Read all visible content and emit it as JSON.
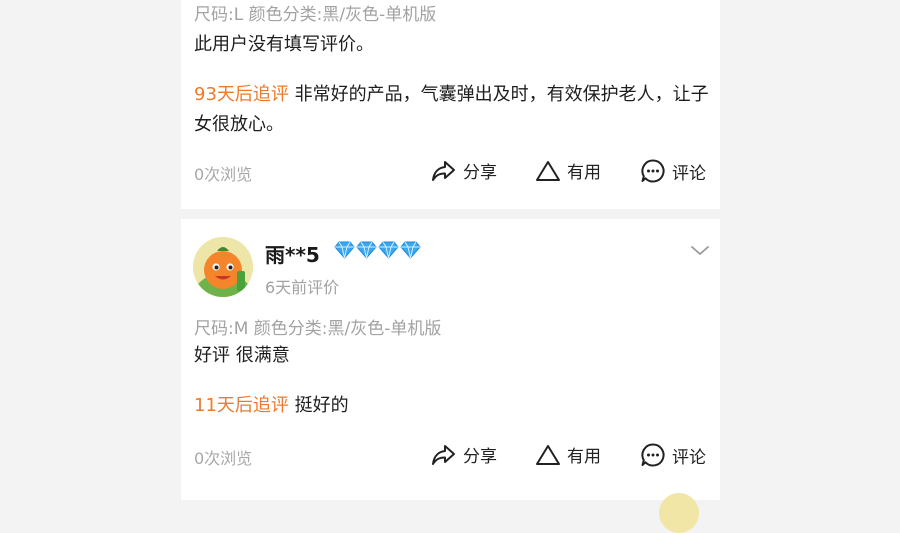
{
  "review1": {
    "sku": "尺码:L 颜色分类:黑/灰色-单机版",
    "text": "此用户没有填写评价。",
    "followup_label": "93天后追评",
    "followup_text": " 非常好的产品，气囊弹出及时，有效保护老人，让子女很放心。",
    "views": "0次浏览",
    "share_label": "分享",
    "useful_label": "有用",
    "comment_label": "评论"
  },
  "review2": {
    "username": "雨**5",
    "date": "6天前评价",
    "sku": "尺码:M 颜色分类:黑/灰色-单机版",
    "text": "好评 很满意",
    "followup_label": "11天后追评",
    "followup_text": " 挺好的",
    "views": "0次浏览",
    "share_label": "分享",
    "useful_label": "有用",
    "comment_label": "评论",
    "badge_count": 4
  },
  "icons": {
    "share": "share-arrow-icon",
    "useful": "triangle-icon",
    "comment": "speech-bubble-icon",
    "chevron": "chevron-down-icon",
    "diamond": "diamond-icon"
  },
  "colors": {
    "followup": "#ee7a2b",
    "diamond": "#3aa7ee"
  }
}
